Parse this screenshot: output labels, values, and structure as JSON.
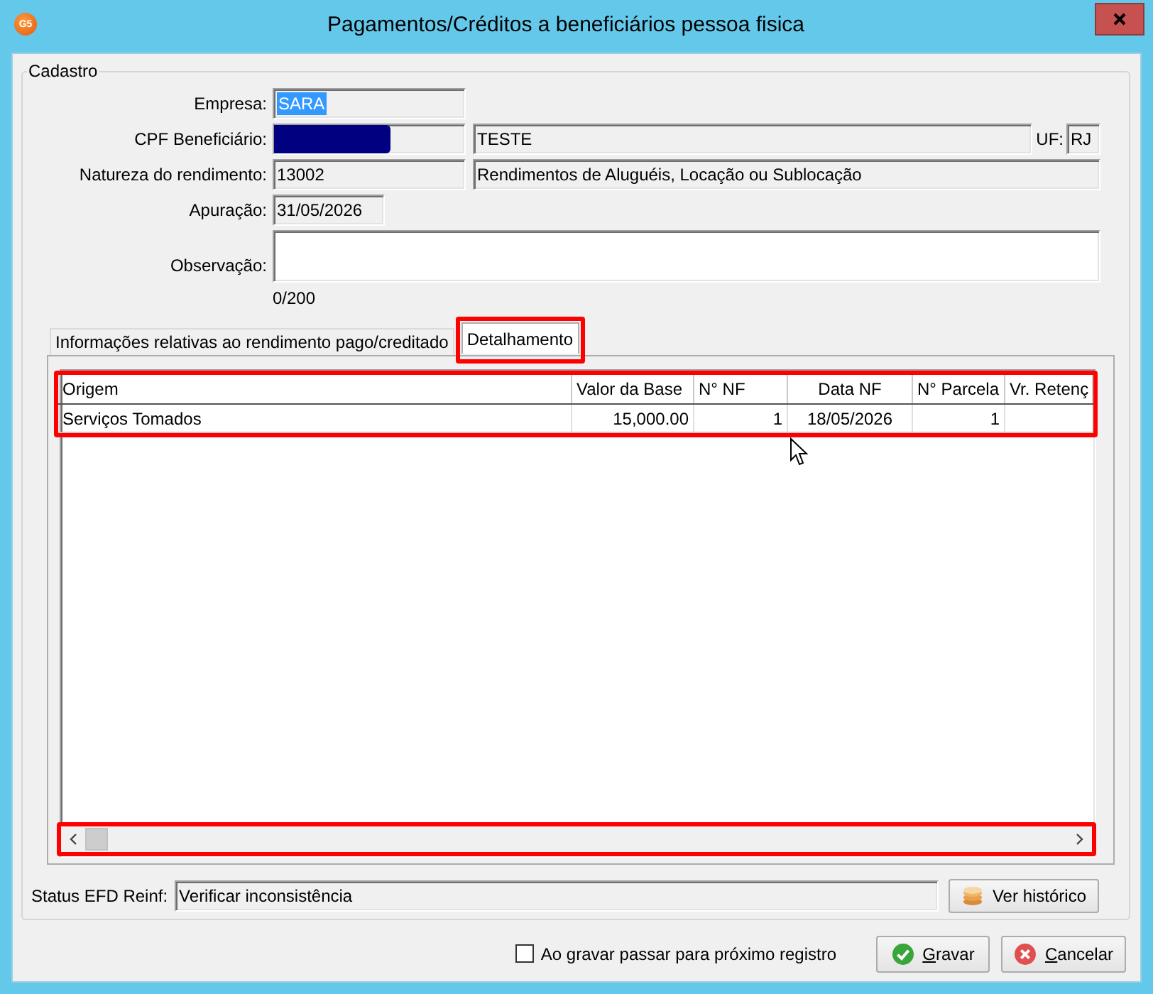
{
  "window": {
    "title": "Pagamentos/Créditos a beneficiários pessoa fisica",
    "app_icon_text": "G5"
  },
  "cadastro": {
    "title": "Cadastro"
  },
  "empresa": {
    "label": "Empresa:",
    "value": "SARA",
    "selected": true
  },
  "cpf": {
    "label": "CPF Beneficiário:",
    "redacted": true,
    "name": "TESTE",
    "uf_label": "UF:",
    "uf": "RJ"
  },
  "natureza": {
    "label": "Natureza do rendimento:",
    "code": "13002",
    "description": "Rendimentos de Aluguéis, Locação ou Sublocação"
  },
  "apuracao": {
    "label": "Apuração:",
    "value": "31/05/2026"
  },
  "observacao": {
    "label": "Observação:",
    "counter": "0/200"
  },
  "tabs": [
    {
      "label": "Informações relativas ao rendimento pago/creditado",
      "selected": false,
      "highlighted": false
    },
    {
      "label": "Detalhamento",
      "selected": true,
      "highlighted": true
    }
  ],
  "detail_table": {
    "highlighted": true,
    "scrollbar_highlighted": true,
    "columns": [
      {
        "label": "Origem",
        "kind": "text"
      },
      {
        "label": "Valor da Base",
        "kind": "number"
      },
      {
        "label": "N° NF",
        "kind": "number"
      },
      {
        "label": "Data NF",
        "kind": "date"
      },
      {
        "label": "N° Parcela",
        "kind": "number"
      },
      {
        "label": "Vr. Retenç",
        "kind": "number"
      }
    ],
    "rows": [
      {
        "cells": [
          "Serviços Tomados",
          "15,000.00",
          "1",
          "18/05/2026",
          "1"
        ]
      }
    ]
  },
  "status": {
    "label": "Status EFD Reinf:",
    "value": "Verificar inconsistência",
    "history_button": "Ver histórico"
  },
  "footer": {
    "next_record": {
      "label": "Ao gravar passar para próximo registro",
      "checked": false
    },
    "buttons": [
      {
        "label": "Gravar",
        "kind": "save",
        "mnemonic_underlined": true
      },
      {
        "label": "Cancelar",
        "kind": "cancel",
        "mnemonic_underlined": true
      }
    ]
  }
}
